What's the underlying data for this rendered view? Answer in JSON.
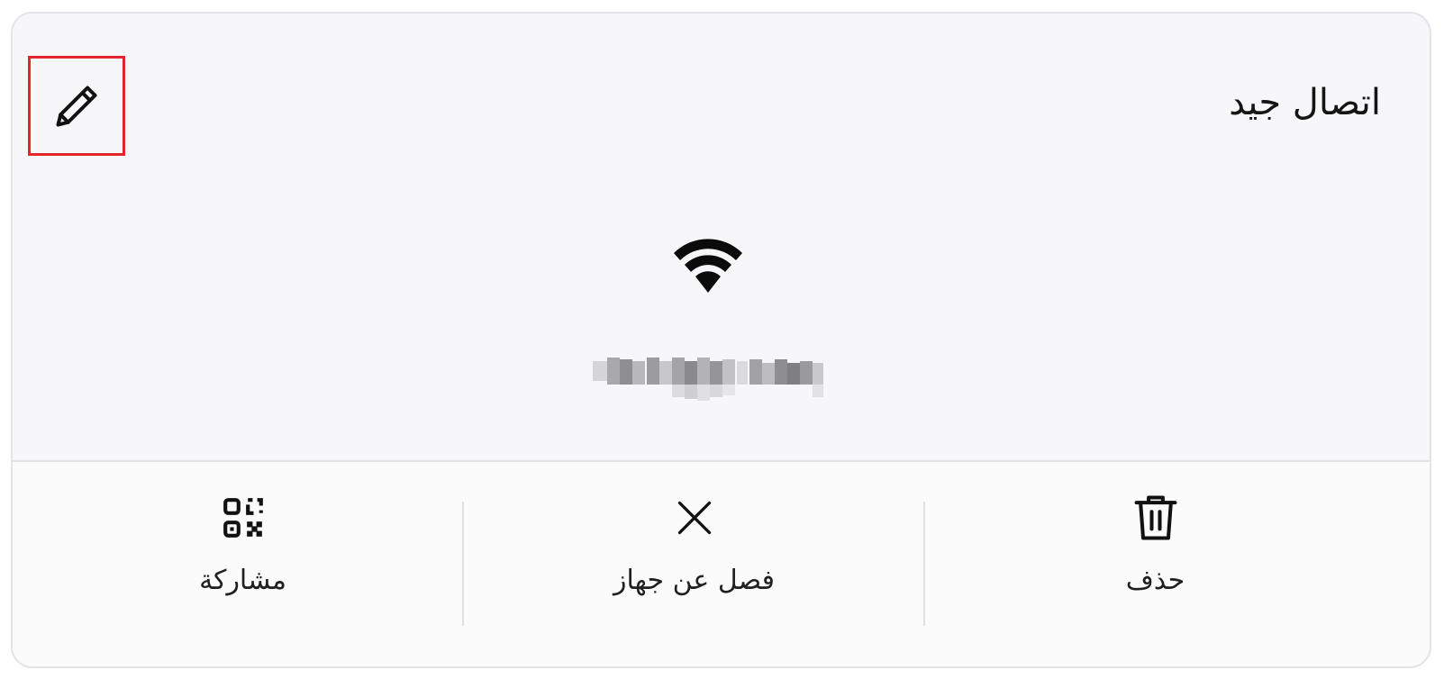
{
  "header": {
    "status_text": "اتصال جيد",
    "edit_icon": "pencil-icon",
    "edit_highlight_color": "#e3262d"
  },
  "network": {
    "signal_icon": "wifi-full-icon"
  },
  "actions": [
    {
      "id": "share",
      "label": "مشاركة",
      "icon": "qr-code-icon"
    },
    {
      "id": "disconnect",
      "label": "فصل عن جهاز",
      "icon": "close-icon"
    },
    {
      "id": "delete",
      "label": "حذف",
      "icon": "trash-icon"
    }
  ]
}
